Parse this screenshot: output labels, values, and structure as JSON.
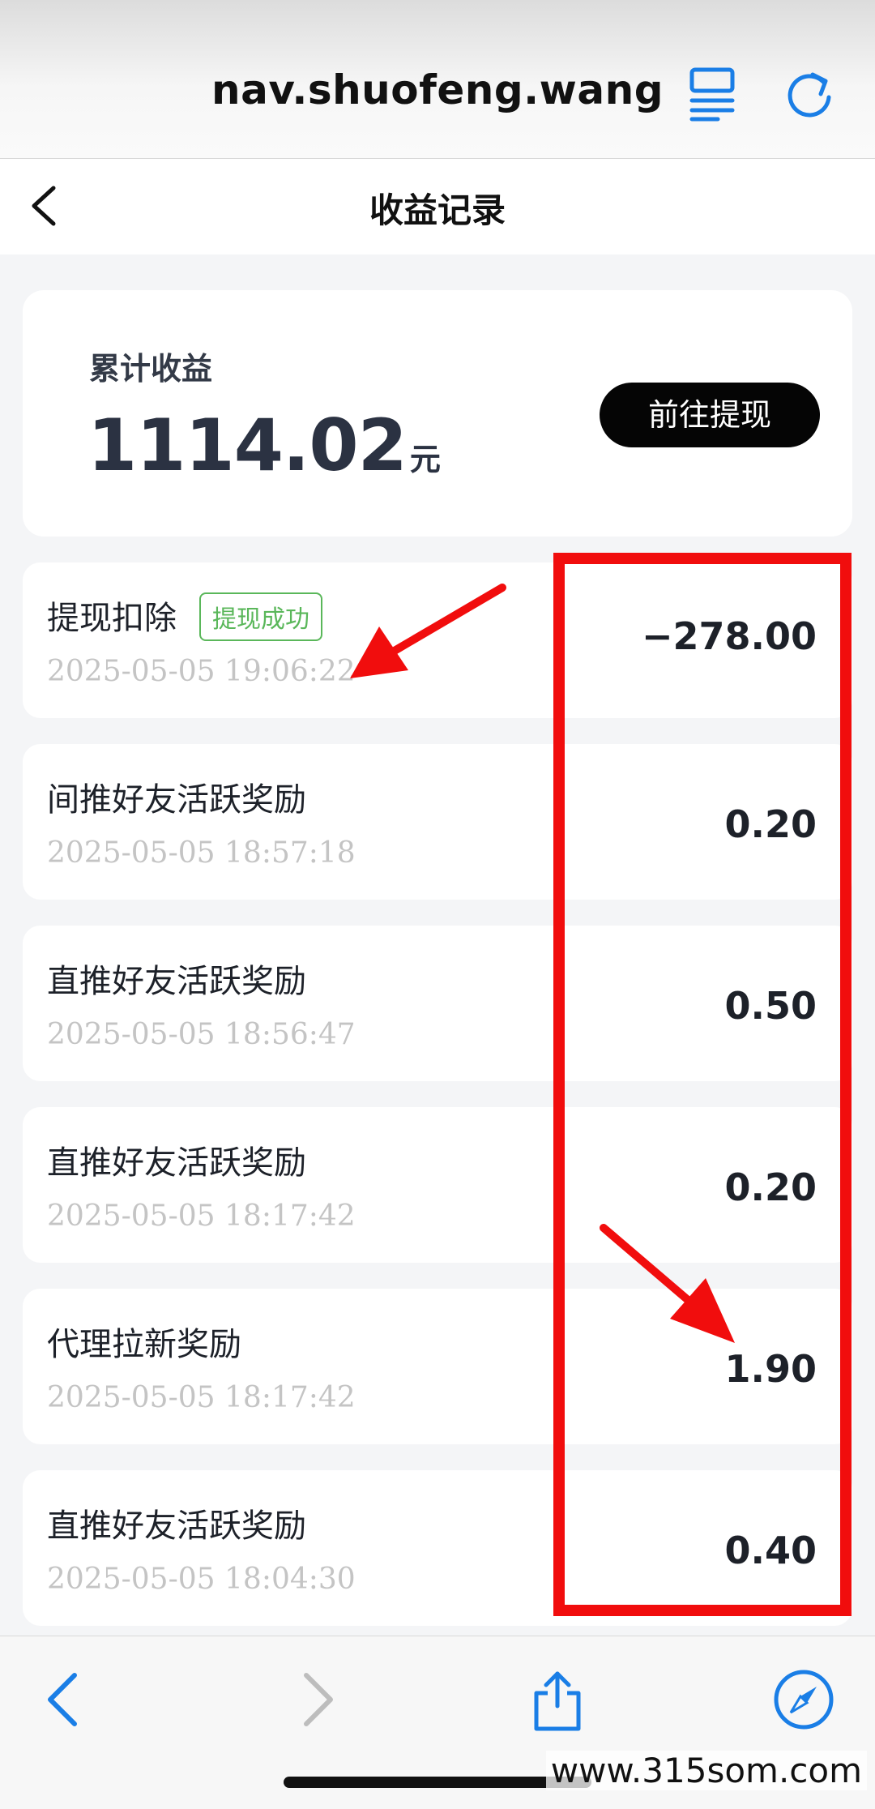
{
  "browser": {
    "url": "nav.shuofeng.wang"
  },
  "header": {
    "title": "收益记录"
  },
  "summary": {
    "label": "累计收益",
    "value": "1114.02",
    "unit": "元",
    "withdraw_button": "前往提现"
  },
  "records": [
    {
      "title": "提现扣除",
      "badge": "提现成功",
      "time": "2025-05-05 19:06:22",
      "amount": "−278.00"
    },
    {
      "title": "间推好友活跃奖励",
      "time": "2025-05-05 18:57:18",
      "amount": "0.20"
    },
    {
      "title": "直推好友活跃奖励",
      "time": "2025-05-05 18:56:47",
      "amount": "0.50"
    },
    {
      "title": "直推好友活跃奖励",
      "time": "2025-05-05 18:17:42",
      "amount": "0.20"
    },
    {
      "title": "代理拉新奖励",
      "time": "2025-05-05 18:17:42",
      "amount": "1.90"
    },
    {
      "title": "直推好友活跃奖励",
      "time": "2025-05-05 18:04:30",
      "amount": "0.40"
    }
  ],
  "watermark": "www.315som.com",
  "colors": {
    "accent": "#1a7ee6",
    "highlight": "#f10d0d",
    "badge": "#5ab75a"
  }
}
